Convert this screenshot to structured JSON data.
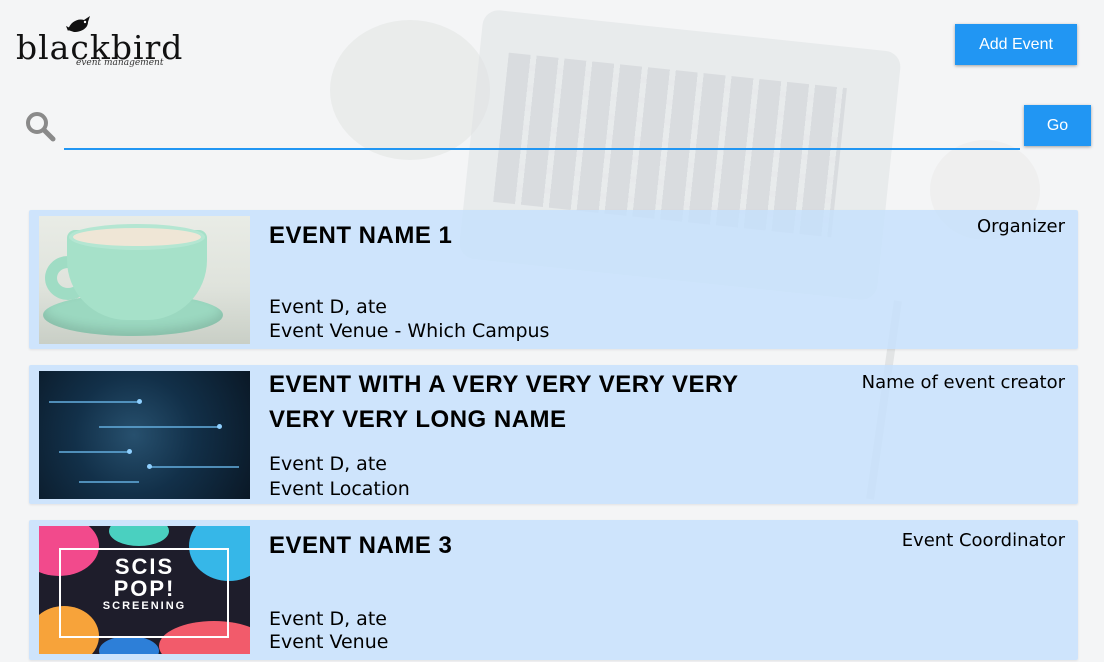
{
  "logo": {
    "wordmark": "blackbird",
    "tagline": "event management"
  },
  "header": {
    "add_event_label": "Add Event"
  },
  "search": {
    "value": "",
    "go_label": "Go"
  },
  "colors": {
    "accent": "#2196f3",
    "card_background": "#c6e0fc"
  },
  "events": [
    {
      "title": "EVENT NAME 1",
      "owner": "Organizer",
      "date": "Event D, ate",
      "location": "Event Venue - Which Campus",
      "image": "coffee-cup-thumbnail"
    },
    {
      "title": "EVENT WITH A VERY VERY VERY VERY VERY VERY LONG NAME",
      "owner": "Name of event creator",
      "date": "Event D, ate",
      "location": "Event Location",
      "image": "circuit-board-thumbnail"
    },
    {
      "title": "EVENT NAME 3",
      "owner": "Event Coordinator",
      "date": "Event D, ate",
      "location": "Event Venue",
      "image": "scis-pop-screening-poster-thumbnail",
      "poster_text": {
        "line1": "SCIS",
        "line2": "POP!",
        "line3": "SCREENING"
      }
    }
  ]
}
